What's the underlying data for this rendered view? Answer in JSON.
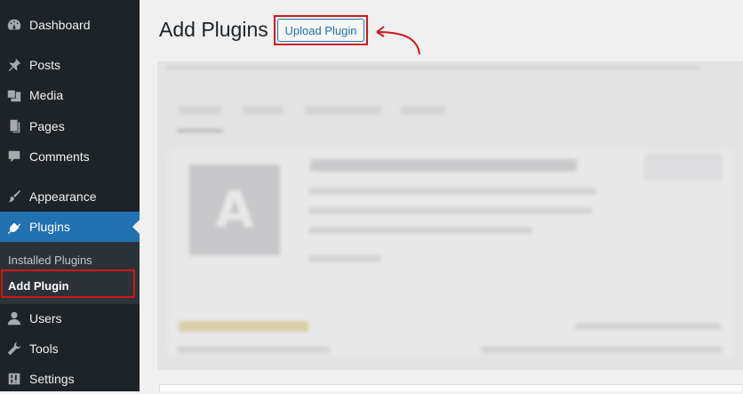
{
  "sidebar": {
    "items": [
      {
        "label": "Dashboard",
        "icon": "dashboard-icon"
      },
      {
        "label": "Posts",
        "icon": "pin-icon"
      },
      {
        "label": "Media",
        "icon": "media-icon"
      },
      {
        "label": "Pages",
        "icon": "pages-icon"
      },
      {
        "label": "Comments",
        "icon": "comment-icon"
      },
      {
        "label": "Appearance",
        "icon": "brush-icon"
      },
      {
        "label": "Plugins",
        "icon": "plug-icon"
      },
      {
        "label": "Users",
        "icon": "user-icon"
      },
      {
        "label": "Tools",
        "icon": "wrench-icon"
      },
      {
        "label": "Settings",
        "icon": "settings-icon"
      }
    ],
    "active_item": "Plugins",
    "submenu": [
      {
        "label": "Installed Plugins"
      },
      {
        "label": "Add Plugin"
      }
    ],
    "current_submenu": "Add Plugin"
  },
  "main": {
    "title": "Add Plugins",
    "upload_button": "Upload Plugin"
  },
  "colors": {
    "sidebar_bg": "#1d2327",
    "accent": "#2271b1",
    "highlight": "#cc1818"
  }
}
